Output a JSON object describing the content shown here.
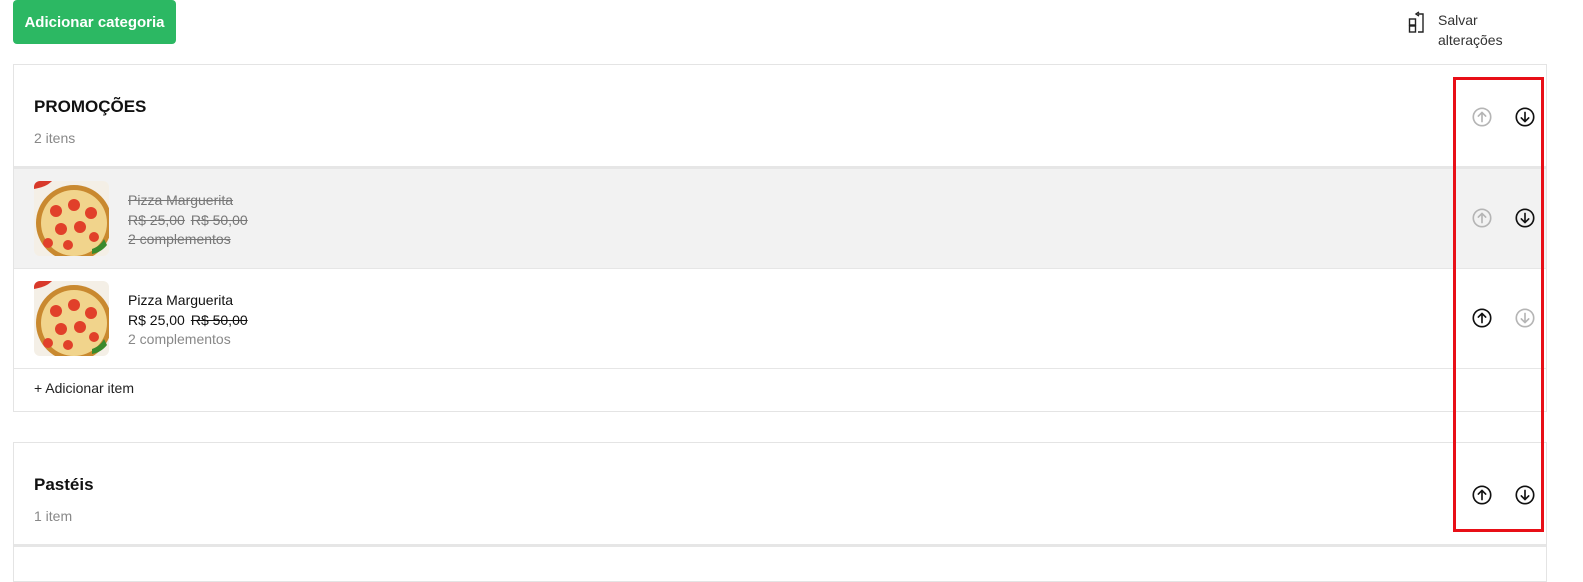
{
  "toolbar": {
    "add_category_label": "Adicionar categoria",
    "save_label_line1": "Salvar",
    "save_label_line2": "alterações"
  },
  "categories": [
    {
      "name": "PROMOÇÕES",
      "count": "2 itens",
      "up_enabled": false,
      "down_enabled": true,
      "items": [
        {
          "name": "Pizza Marguerita",
          "price": "R$ 25,00",
          "old_price": "R$ 50,00",
          "addons": "2 complementos",
          "disabled": true,
          "up_enabled": false,
          "down_enabled": true
        },
        {
          "name": "Pizza Marguerita",
          "price": "R$ 25,00",
          "old_price": "R$ 50,00",
          "addons": "2 complementos",
          "disabled": false,
          "up_enabled": true,
          "down_enabled": false
        }
      ],
      "add_item_label": "+ Adicionar item"
    },
    {
      "name": "Pastéis",
      "count": "1 item",
      "up_enabled": true,
      "down_enabled": true
    }
  ],
  "colors": {
    "primary_green": "#2cb863",
    "highlight_red": "#e80f17",
    "disabled_arrow": "#b5b5b5",
    "active_arrow": "#111111"
  },
  "icons": {
    "up": "arrow-up-circle-icon",
    "down": "arrow-down-circle-icon",
    "save": "save-reorder-icon"
  }
}
